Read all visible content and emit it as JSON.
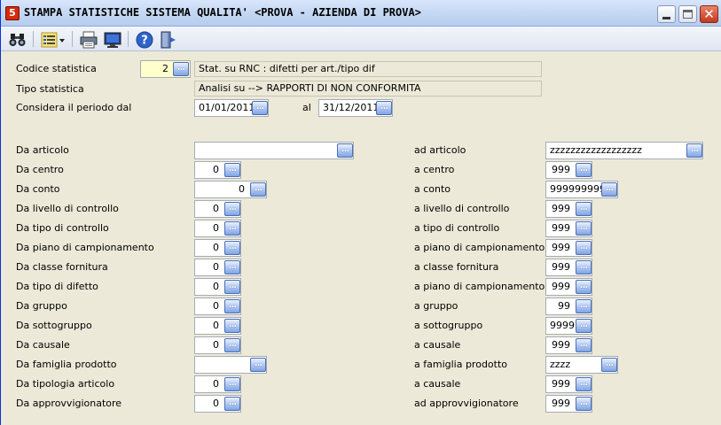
{
  "window": {
    "title": "STAMPA STATISTICHE SISTEMA QUALITA' <PROVA - AZIENDA DI PROVA>",
    "app_icon_letter": "5"
  },
  "toolbar": {
    "icons": [
      "binoculars-icon",
      "list-options-icon",
      "printer-icon",
      "monitor-preview-icon",
      "help-icon",
      "exit-door-icon"
    ]
  },
  "header": {
    "codice_label": "Codice statistica",
    "codice_value": "2",
    "codice_desc": "Stat. su RNC : difetti per art./tipo dif",
    "tipo_label": "Tipo statistica",
    "tipo_desc": "Analisi su -->  RAPPORTI DI NON CONFORMITA",
    "periodo_label": "Considera il periodo dal",
    "date_from": "01/01/2011",
    "al_label": "al",
    "date_to": "31/12/2011"
  },
  "left_rows": [
    {
      "label": "Da articolo",
      "value": ""
    },
    {
      "label": "Da centro",
      "value": "0"
    },
    {
      "label": "Da conto",
      "value": "0"
    },
    {
      "label": "Da livello di controllo",
      "value": "0"
    },
    {
      "label": "Da tipo di controllo",
      "value": "0"
    },
    {
      "label": "Da piano di campionamento",
      "value": "0"
    },
    {
      "label": "Da classe fornitura",
      "value": "0"
    },
    {
      "label": "Da tipo di difetto",
      "value": "0"
    },
    {
      "label": "Da gruppo",
      "value": "0"
    },
    {
      "label": "Da sottogruppo",
      "value": "0"
    },
    {
      "label": "Da causale",
      "value": "0"
    },
    {
      "label": "Da famiglia prodotto",
      "value": ""
    },
    {
      "label": "Da tipologia articolo",
      "value": "0"
    },
    {
      "label": "Da approvvigionatore",
      "value": "0"
    }
  ],
  "right_rows": [
    {
      "label": "ad articolo",
      "value": "zzzzzzzzzzzzzzzzzz"
    },
    {
      "label": "a centro",
      "value": "999"
    },
    {
      "label": "a conto",
      "value": "999999999"
    },
    {
      "label": "a livello di controllo",
      "value": "999"
    },
    {
      "label": "a tipo di controllo",
      "value": "999"
    },
    {
      "label": "a piano di campionamento",
      "value": "999"
    },
    {
      "label": "a classe fornitura",
      "value": "999"
    },
    {
      "label": "a piano di campionamento",
      "value": "999"
    },
    {
      "label": "a gruppo",
      "value": "99"
    },
    {
      "label": "a sottogruppo",
      "value": "9999"
    },
    {
      "label": "a causale",
      "value": "999"
    },
    {
      "label": "a famiglia prodotto",
      "value": "zzzz"
    },
    {
      "label": "a causale",
      "value": "999"
    },
    {
      "label": "ad approvvigionatore",
      "value": "999"
    }
  ],
  "lookup_button_label": "..."
}
